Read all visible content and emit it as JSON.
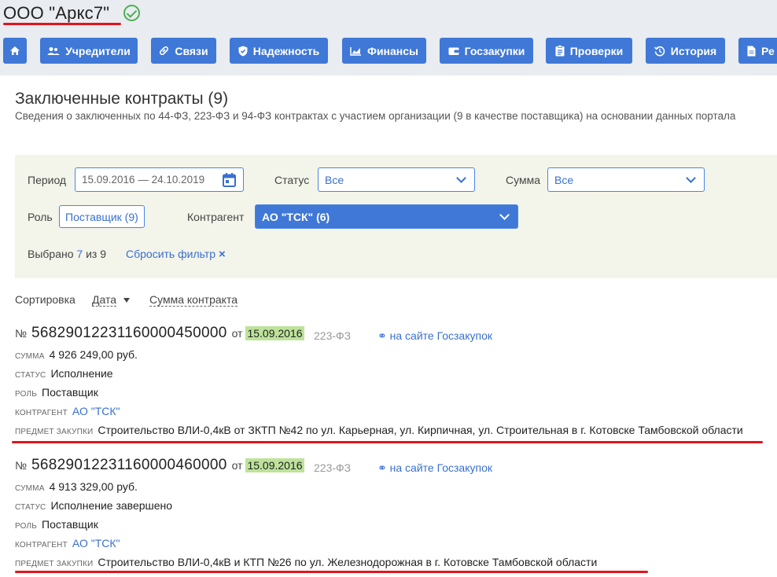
{
  "company": {
    "name": "ООО \"Аркс7\"",
    "verified_icon": "check-circle-icon"
  },
  "nav": [
    {
      "label": "",
      "icon": "home-icon"
    },
    {
      "label": "Учредители",
      "icon": "people-icon"
    },
    {
      "label": "Связи",
      "icon": "link-icon"
    },
    {
      "label": "Надежность",
      "icon": "shield-icon"
    },
    {
      "label": "Финансы",
      "icon": "chart-icon"
    },
    {
      "label": "Госзакупки",
      "icon": "wallet-icon"
    },
    {
      "label": "Проверки",
      "icon": "clipboard-icon"
    },
    {
      "label": "История",
      "icon": "history-icon"
    },
    {
      "label": "Ре",
      "icon": "document-icon"
    }
  ],
  "section": {
    "title": "Заключенные контракты (9)",
    "subtitle": "Сведения о заключенных по 44-ФЗ, 223-ФЗ и 94-ФЗ контрактах с участием организации (9 в качестве поставщика) на основании данных портала"
  },
  "filters": {
    "period_label": "Период",
    "period_value": "15.09.2016 — 24.10.2019",
    "status_label": "Статус",
    "status_value": "Все",
    "sum_label": "Сумма",
    "sum_value": "Все",
    "role_label": "Роль",
    "role_value": "Поставщик (9)",
    "counterparty_label": "Контрагент",
    "counterparty_value": "АО \"ТСК\" (6)",
    "selected_prefix": "Выбрано",
    "selected_count": "7",
    "selected_of": "из 9",
    "reset_label": "Сбросить фильтр"
  },
  "sort": {
    "label": "Сортировка",
    "option_date": "Дата",
    "option_sum": "Сумма контракта"
  },
  "contract_labels": {
    "no": "№",
    "from": "от",
    "sum": "сумма",
    "status": "статус",
    "role": "роль",
    "counterparty": "контрагент",
    "subject": "предмет закупки",
    "link": "на сайте Госзакупок"
  },
  "contracts": [
    {
      "number": "568290122311600004500 00",
      "date": "15.09.2016",
      "law": "223-ФЗ",
      "sum": "4 926 249,00 руб.",
      "status": "Исполнение",
      "role": "Поставщик",
      "counterparty": "АО \"ТСК\"",
      "subject": "Строительство ВЛИ-0,4кВ от ЗКТП №42 по ул. Карьерная, ул. Кирпичная, ул. Строительная в г. Котовске Тамбовской области"
    },
    {
      "number": "568290122311600004600 00",
      "date": "15.09.2016",
      "law": "223-ФЗ",
      "sum": "4 913 329,00 руб.",
      "status": "Исполнение завершено",
      "role": "Поставщик",
      "counterparty": "АО \"ТСК\"",
      "subject": "Строительство ВЛИ-0,4кВ и КТП №26 по ул. Железнодорожная в г. Котовске Тамбовской области"
    }
  ],
  "colors": {
    "accent": "#3f78d6",
    "highlight_date": "#bde39a",
    "annotation": "#e3141b"
  }
}
